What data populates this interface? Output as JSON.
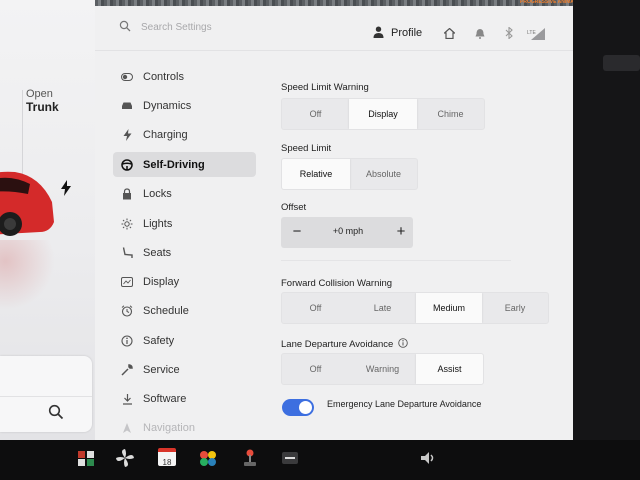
{
  "car_panel": {
    "open_label": "Open",
    "trunk_label": "Trunk",
    "bolt_icon": "lightning-bolt-icon",
    "search_icon": "search-icon",
    "car_color": "#d42a2a"
  },
  "map_strip": {
    "brand_text": "PROGRESSIVE\nANIMAL CO"
  },
  "header": {
    "search_placeholder": "Search Settings",
    "profile_label": "Profile",
    "icons": [
      "search-icon",
      "profile-icon",
      "home-icon",
      "bell-icon",
      "bluetooth-icon",
      "lte-signal-icon"
    ]
  },
  "sidebar": {
    "items": [
      {
        "label": "Controls",
        "icon": "toggle-icon",
        "active": false
      },
      {
        "label": "Dynamics",
        "icon": "car-icon",
        "active": false
      },
      {
        "label": "Charging",
        "icon": "bolt-icon",
        "active": false
      },
      {
        "label": "Self-Driving",
        "icon": "steering-wheel-icon",
        "active": true
      },
      {
        "label": "Locks",
        "icon": "lock-icon",
        "active": false
      },
      {
        "label": "Lights",
        "icon": "sun-icon",
        "active": false
      },
      {
        "label": "Seats",
        "icon": "seat-icon",
        "active": false
      },
      {
        "label": "Display",
        "icon": "display-icon",
        "active": false
      },
      {
        "label": "Schedule",
        "icon": "clock-icon",
        "active": false
      },
      {
        "label": "Safety",
        "icon": "info-circle-icon",
        "active": false
      },
      {
        "label": "Service",
        "icon": "wrench-icon",
        "active": false
      },
      {
        "label": "Software",
        "icon": "download-icon",
        "active": false
      },
      {
        "label": "Navigation",
        "icon": "nav-arrow-icon",
        "active": false
      }
    ]
  },
  "content": {
    "speed_limit_warning": {
      "title": "Speed Limit Warning",
      "options": [
        "Off",
        "Display",
        "Chime"
      ],
      "selected": "Display"
    },
    "speed_limit": {
      "title": "Speed Limit",
      "options": [
        "Relative",
        "Absolute"
      ],
      "selected": "Relative"
    },
    "offset": {
      "title": "Offset",
      "value": "+0 mph",
      "minus": "−",
      "plus": "+"
    },
    "forward_collision_warning": {
      "title": "Forward Collision Warning",
      "options": [
        "Off",
        "Late",
        "Medium",
        "Early"
      ],
      "selected": "Medium"
    },
    "lane_departure_avoidance": {
      "title": "Lane Departure Avoidance",
      "options": [
        "Off",
        "Warning",
        "Assist"
      ],
      "selected": "Assist"
    },
    "emergency_lane": {
      "label": "Emergency Lane Departure Avoidance",
      "enabled": true
    }
  },
  "taskbar": {
    "calendar_day": "18",
    "icons": [
      "phone-icon",
      "fan-icon",
      "calendar-icon",
      "games-icon",
      "joystick-icon",
      "dashcam-icon",
      "volume-icon"
    ]
  },
  "colors": {
    "accent": "#3d6fe0",
    "car_red": "#d42a2a",
    "panel_bg": "#f0f0f1"
  }
}
